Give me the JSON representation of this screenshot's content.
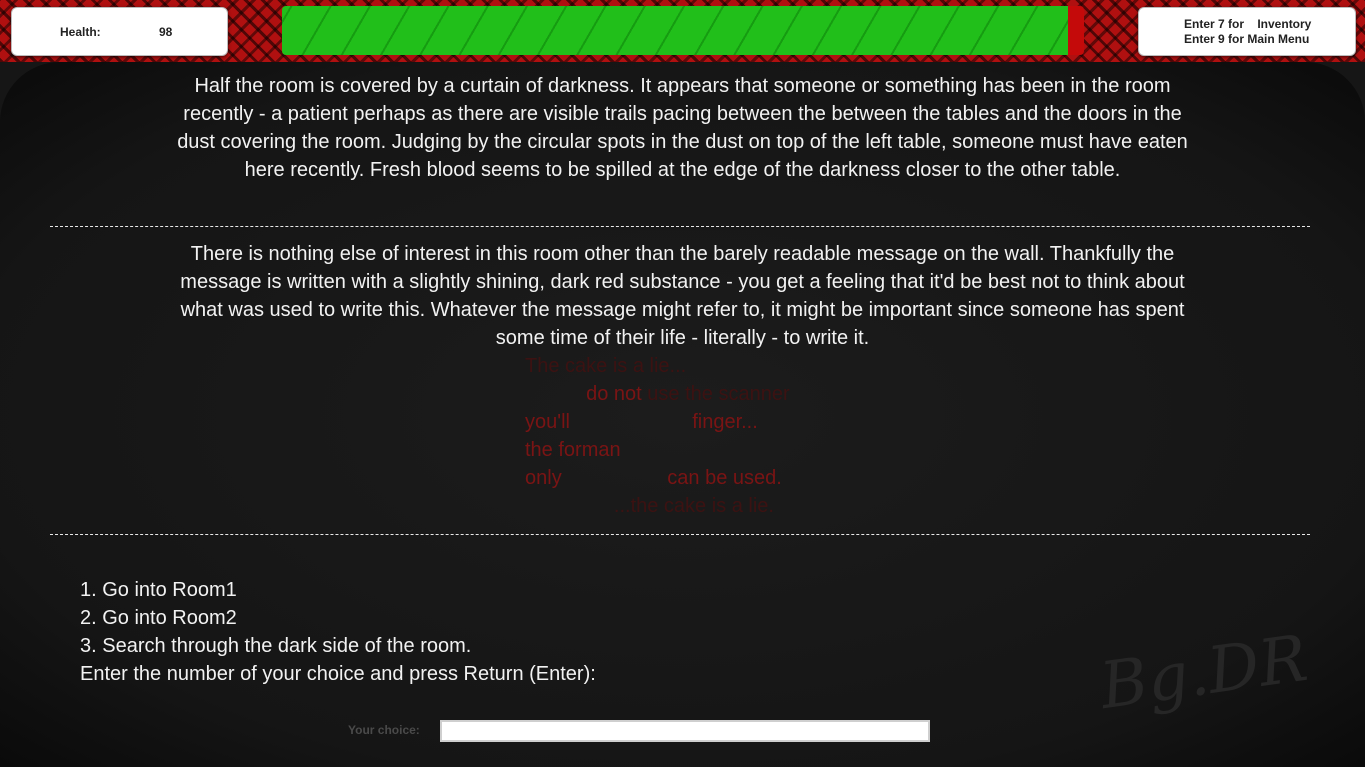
{
  "colors": {
    "health_fill": "#21bf1a",
    "health_empty": "#c40a0a",
    "header_pattern": "#b01010",
    "blood_text_faint": "#3c1212",
    "blood_text": "#7a1414"
  },
  "hud": {
    "health_label": "Health:",
    "health_value": "98",
    "health_fraction": 0.98,
    "menu_line1": "Enter 7 for    Inventory",
    "menu_line2": "Enter 9 for Main Menu"
  },
  "story": {
    "paragraph1": "Half the room is covered by a curtain of darkness. It appears that someone or something has been in the room recently - a patient perhaps as there are visible trails pacing between the between the tables and the doors in the dust covering the room. Judging by the circular spots in the dust on top of the left table, someone must have eaten here recently. Fresh blood seems to be spilled at the edge of the darkness closer to the other table.",
    "paragraph2": "There is nothing else of interest in this room other than the barely readable message on the wall. Thankfully the message is written with a slightly shining, dark red substance - you get a feeling that it'd be best not to think about what was used to write this. Whatever the message might refer to, it might be important since someone has spent some time of their life - literally - to write it."
  },
  "wall_message": {
    "line1": "The cake is a lie...",
    "line2_a": "           ",
    "line2_b": "do not",
    "line2_c": " use the scanner",
    "line3_a": "you'll",
    "line3_b": "                      ",
    "line3_c": "finger...",
    "line4_a": "the forman",
    "line4_b": "",
    "line5_a": "only",
    "line5_b": "                   ",
    "line5_c": "can be used.",
    "line6": "                ...the cake is a lie."
  },
  "choices": {
    "option1": "1. Go into Room1",
    "option2": "2. Go into Room2",
    "option3": "3. Search through the dark side of the room.",
    "prompt": "Enter the number of your choice and press Return (Enter):",
    "input_label": "Your choice:",
    "input_value": ""
  },
  "signature": "Bg.DR"
}
